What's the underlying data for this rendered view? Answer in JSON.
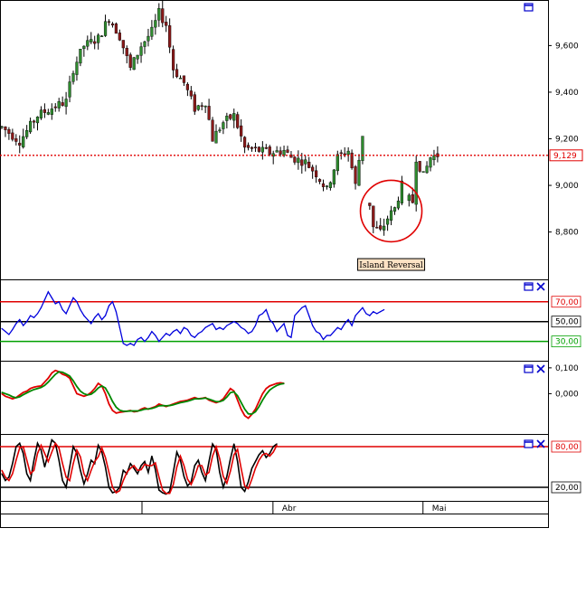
{
  "chart_data": [
    {
      "type": "candlestick",
      "panel": "price",
      "ylim": [
        8.62,
        9.78
      ],
      "yticks": [
        "9,600",
        "9,400",
        "9,200",
        "9,000",
        "8,800"
      ],
      "ytick_values": [
        9.6,
        9.4,
        9.2,
        9.0,
        8.8
      ],
      "last_price": 9.129,
      "last_price_label": "9,129",
      "last_price_color": "#e00000",
      "annotation": {
        "text": "Island Reversal",
        "center_index": 109,
        "center_price": 8.89
      },
      "trend_path": [
        [
          0,
          9.25
        ],
        [
          5,
          9.19
        ],
        [
          10,
          9.3
        ],
        [
          15,
          9.34
        ],
        [
          18,
          9.36
        ],
        [
          20,
          9.5
        ],
        [
          23,
          9.6
        ],
        [
          27,
          9.63
        ],
        [
          30,
          9.72
        ],
        [
          33,
          9.64
        ],
        [
          36,
          9.5
        ],
        [
          39,
          9.6
        ],
        [
          42,
          9.66
        ],
        [
          44,
          9.74
        ],
        [
          46,
          9.69
        ],
        [
          48,
          9.5
        ],
        [
          51,
          9.44
        ],
        [
          54,
          9.33
        ],
        [
          57,
          9.36
        ],
        [
          59,
          9.2
        ],
        [
          62,
          9.27
        ],
        [
          65,
          9.3
        ],
        [
          68,
          9.16
        ],
        [
          72,
          9.15
        ],
        [
          75,
          9.14
        ],
        [
          79,
          9.15
        ],
        [
          81,
          9.12
        ],
        [
          85,
          9.1
        ],
        [
          88,
          9.05
        ],
        [
          91,
          8.98
        ],
        [
          94,
          9.12
        ],
        [
          97,
          9.15
        ],
        [
          99,
          9.0
        ],
        [
          101,
          9.22
        ],
        [
          103,
          8.92
        ],
        [
          104,
          8.82
        ],
        [
          106,
          8.8
        ],
        [
          108,
          8.86
        ],
        [
          110,
          8.9
        ],
        [
          112,
          9.0
        ],
        [
          114,
          8.94
        ],
        [
          115,
          8.93
        ],
        [
          116,
          9.12
        ],
        [
          118,
          9.04
        ],
        [
          120,
          9.12
        ],
        [
          122,
          9.13
        ]
      ]
    },
    {
      "type": "line",
      "panel": "rsi",
      "ylim": [
        16,
        88
      ],
      "levels": [
        {
          "value": 70,
          "label": "70,00",
          "color": "#e00000"
        },
        {
          "value": 50,
          "label": "50,00",
          "color": "#000000"
        },
        {
          "value": 30,
          "label": "30,00",
          "color": "#00a000"
        }
      ],
      "line_color": "#0000dd",
      "values": [
        43,
        40,
        37,
        42,
        48,
        52,
        46,
        50,
        56,
        54,
        58,
        64,
        72,
        80,
        74,
        68,
        70,
        62,
        58,
        66,
        74,
        70,
        62,
        56,
        52,
        48,
        54,
        58,
        52,
        56,
        66,
        70,
        60,
        44,
        28,
        26,
        28,
        26,
        32,
        34,
        30,
        34,
        40,
        36,
        30,
        34,
        38,
        36,
        40,
        42,
        38,
        44,
        42,
        36,
        34,
        38,
        40,
        44,
        46,
        48,
        42,
        44,
        42,
        46,
        48,
        50,
        48,
        44,
        42,
        38,
        40,
        46,
        56,
        58,
        62,
        52,
        48,
        40,
        44,
        48,
        36,
        34,
        56,
        60,
        64,
        66,
        56,
        46,
        40,
        38,
        32,
        36,
        36,
        40,
        44,
        42,
        48,
        52,
        46,
        56,
        60,
        64,
        58,
        56,
        60,
        58,
        60,
        62
      ]
    },
    {
      "type": "line",
      "panel": "oscillator",
      "ylim": [
        -0.135,
        0.11
      ],
      "yticks": [
        "0,100",
        "0,000"
      ],
      "ytick_values": [
        0.1,
        0.0
      ],
      "series": [
        {
          "color": "#e00000",
          "values": [
            0,
            -0.01,
            -0.015,
            -0.02,
            -0.015,
            -0.005,
            0.005,
            0.01,
            0.02,
            0.025,
            0.028,
            0.03,
            0.045,
            0.06,
            0.08,
            0.09,
            0.085,
            0.075,
            0.07,
            0.06,
            0.03,
            0.0,
            -0.005,
            -0.01,
            -0.005,
            0.005,
            0.02,
            0.04,
            0.03,
            0.0,
            -0.04,
            -0.065,
            -0.075,
            -0.072,
            -0.07,
            -0.068,
            -0.065,
            -0.07,
            -0.068,
            -0.06,
            -0.055,
            -0.06,
            -0.055,
            -0.05,
            -0.04,
            -0.045,
            -0.05,
            -0.045,
            -0.04,
            -0.035,
            -0.03,
            -0.028,
            -0.025,
            -0.02,
            -0.015,
            -0.02,
            -0.018,
            -0.015,
            -0.025,
            -0.03,
            -0.035,
            -0.03,
            -0.02,
            0.0,
            0.02,
            0.01,
            -0.025,
            -0.06,
            -0.085,
            -0.095,
            -0.08,
            -0.06,
            -0.03,
            0.0,
            0.02,
            0.03,
            0.035,
            0.04,
            0.042,
            0.04
          ]
        },
        {
          "color": "#008800",
          "values": [
            0.005,
            0.0,
            -0.005,
            -0.012,
            -0.016,
            -0.012,
            -0.004,
            0.003,
            0.01,
            0.016,
            0.02,
            0.024,
            0.032,
            0.045,
            0.06,
            0.075,
            0.085,
            0.083,
            0.076,
            0.068,
            0.05,
            0.028,
            0.01,
            0.0,
            -0.005,
            -0.002,
            0.008,
            0.022,
            0.03,
            0.022,
            -0.002,
            -0.03,
            -0.052,
            -0.064,
            -0.068,
            -0.068,
            -0.067,
            -0.067,
            -0.067,
            -0.064,
            -0.06,
            -0.059,
            -0.057,
            -0.053,
            -0.047,
            -0.046,
            -0.047,
            -0.046,
            -0.043,
            -0.039,
            -0.035,
            -0.032,
            -0.029,
            -0.025,
            -0.02,
            -0.02,
            -0.019,
            -0.017,
            -0.021,
            -0.026,
            -0.031,
            -0.031,
            -0.026,
            -0.013,
            0.004,
            0.007,
            -0.008,
            -0.034,
            -0.06,
            -0.078,
            -0.079,
            -0.07,
            -0.05,
            -0.025,
            -0.003,
            0.014,
            0.024,
            0.032,
            0.037,
            0.039
          ]
        }
      ]
    },
    {
      "type": "line",
      "panel": "stochastic",
      "ylim": [
        8,
        92
      ],
      "levels": [
        {
          "value": 80,
          "label": "80,00",
          "color": "#e00000"
        },
        {
          "value": 20,
          "label": "20,00",
          "color": "#000000"
        }
      ],
      "series": [
        {
          "color": "#000000",
          "values": [
            40,
            30,
            35,
            55,
            80,
            85,
            70,
            40,
            30,
            60,
            85,
            75,
            50,
            70,
            90,
            85,
            60,
            30,
            20,
            50,
            80,
            70,
            45,
            25,
            40,
            60,
            55,
            82,
            72,
            50,
            20,
            12,
            14,
            20,
            45,
            40,
            55,
            48,
            40,
            52,
            58,
            42,
            66,
            46,
            16,
            12,
            10,
            14,
            42,
            72,
            60,
            36,
            22,
            28,
            52,
            60,
            42,
            30,
            58,
            84,
            76,
            42,
            20,
            36,
            62,
            84,
            58,
            20,
            14,
            28,
            48,
            58,
            68,
            74,
            64,
            70,
            80,
            84
          ]
        },
        {
          "color": "#e00000",
          "values": [
            45,
            35,
            30,
            40,
            60,
            78,
            80,
            60,
            40,
            45,
            70,
            82,
            70,
            58,
            72,
            85,
            78,
            55,
            35,
            30,
            55,
            75,
            65,
            40,
            30,
            45,
            58,
            65,
            78,
            64,
            42,
            20,
            12,
            15,
            30,
            42,
            48,
            52,
            45,
            46,
            54,
            52,
            52,
            56,
            35,
            16,
            11,
            11,
            24,
            50,
            66,
            52,
            32,
            24,
            36,
            52,
            52,
            38,
            42,
            66,
            80,
            62,
            36,
            26,
            44,
            68,
            76,
            48,
            22,
            18,
            32,
            48,
            60,
            68,
            70,
            66,
            72,
            82
          ]
        }
      ]
    }
  ],
  "x_axis": {
    "labels": [
      {
        "text": "Abr",
        "index": 83
      },
      {
        "text": "Mai",
        "index": 125
      }
    ]
  }
}
